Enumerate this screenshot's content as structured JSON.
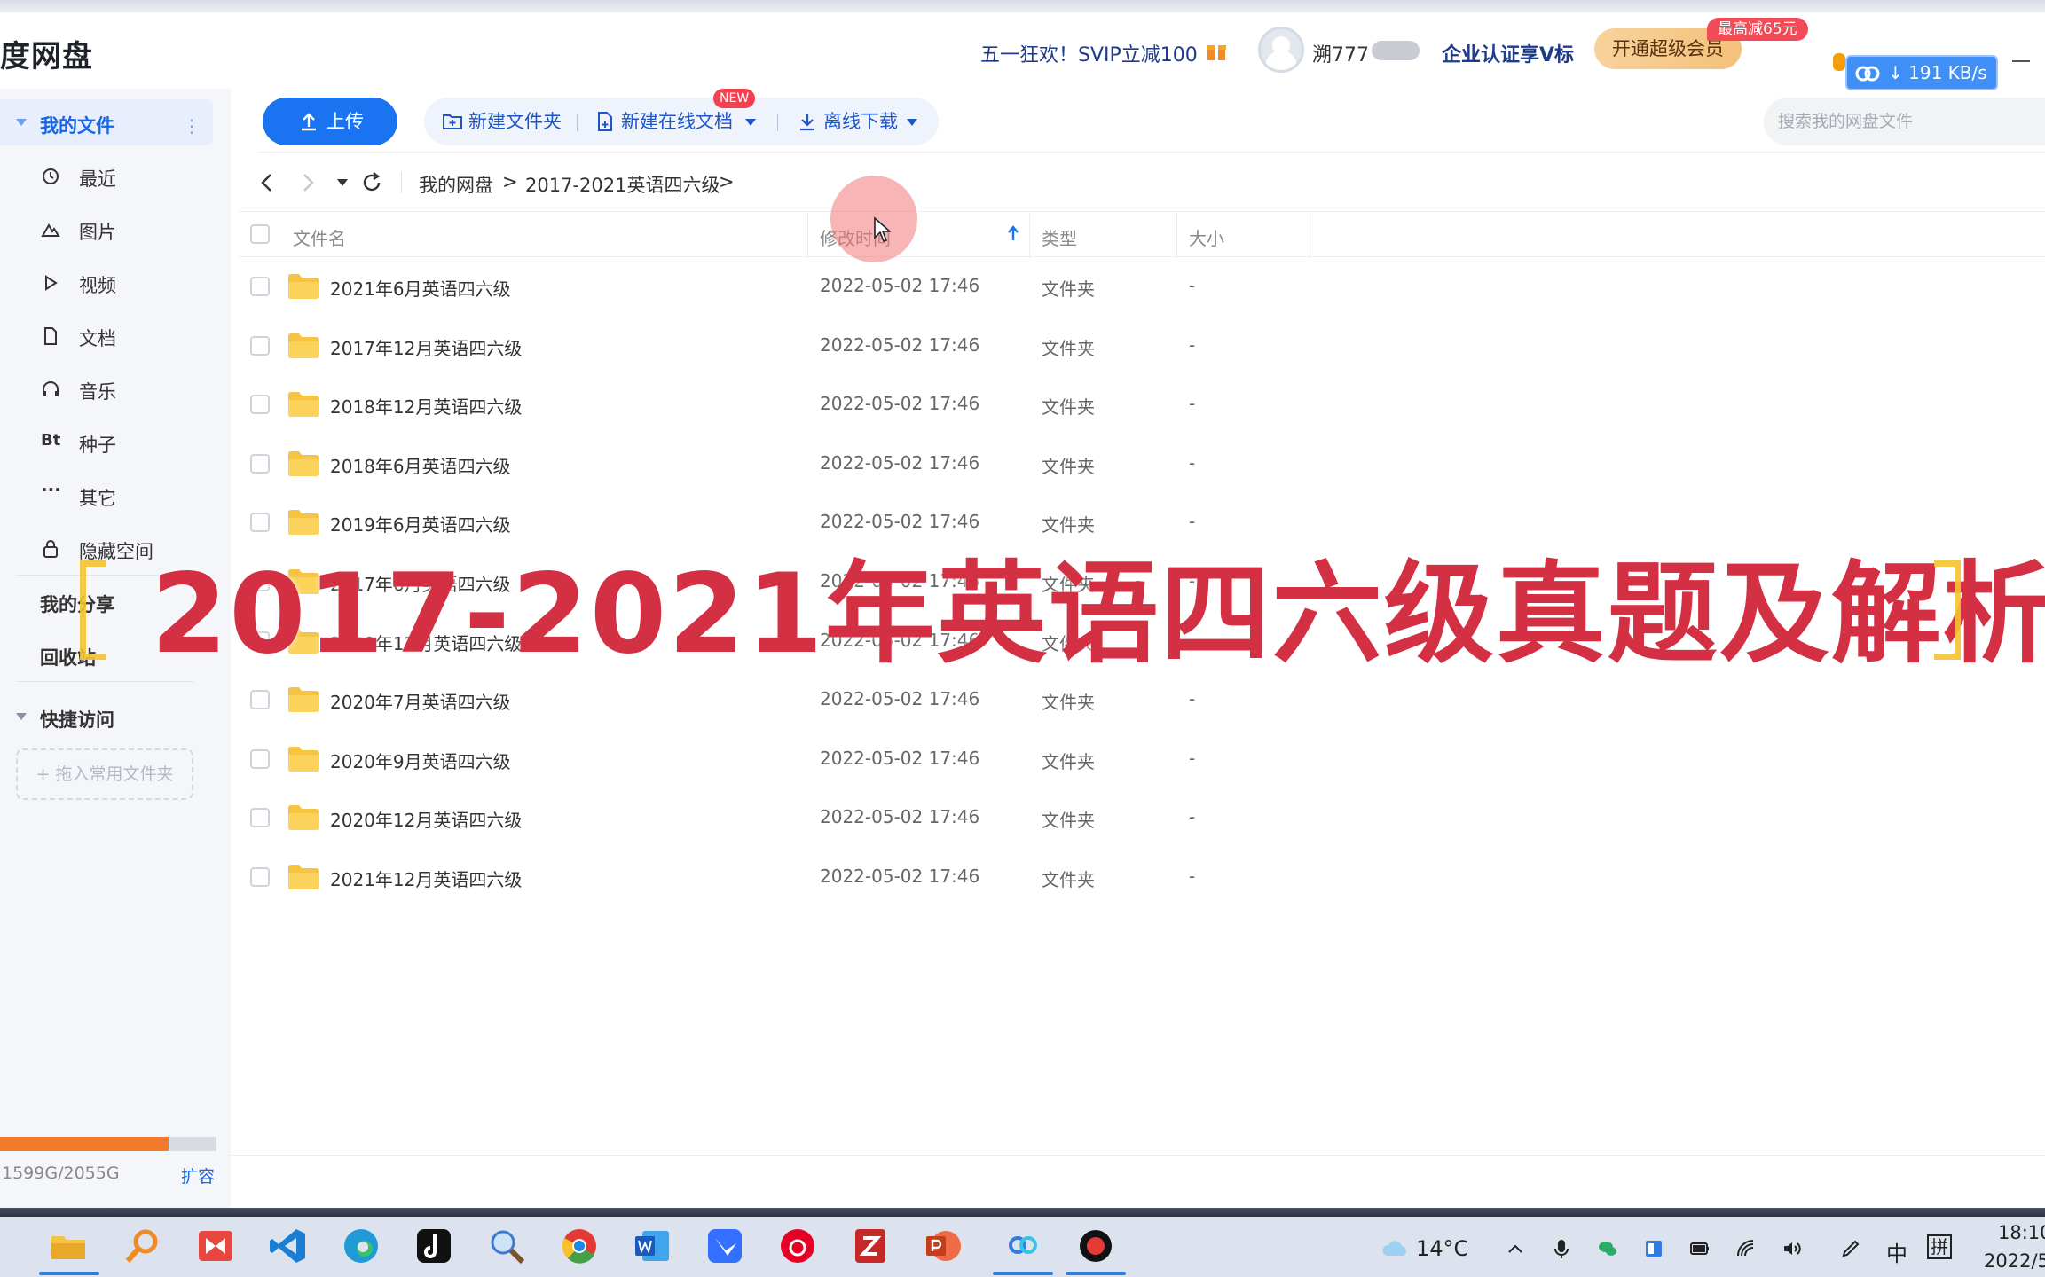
{
  "titlebar": {
    "app_title": "度网盘",
    "promo": "五一狂欢！SVIP立减100",
    "username": "溯777",
    "enterprise_label": "企业认证享V标",
    "svip_button": "开通超级会员",
    "discount_tag": "最高减65元",
    "download_speed": "191 KB/s"
  },
  "sidebar": {
    "my_files": "我的文件",
    "items": [
      {
        "label": "最近",
        "icon": "clock-icon"
      },
      {
        "label": "图片",
        "icon": "image-icon"
      },
      {
        "label": "视频",
        "icon": "play-icon"
      },
      {
        "label": "文档",
        "icon": "document-icon"
      },
      {
        "label": "音乐",
        "icon": "headphones-icon"
      },
      {
        "label": "种子",
        "icon": "bt-icon"
      },
      {
        "label": "其它",
        "icon": "more-icon"
      },
      {
        "label": "隐藏空间",
        "icon": "lock-icon"
      }
    ],
    "my_share": "我的分享",
    "recycle": "回收站",
    "quick_access": "快捷访问",
    "drop_zone": "+ 拖入常用文件夹",
    "bt_glyph": "Bt",
    "storage": "1599G/2055G",
    "storage_used_fraction": 0.778,
    "expand": "扩容"
  },
  "toolbar": {
    "upload": "上传",
    "new_folder": "新建文件夹",
    "new_online_doc": "新建在线文档",
    "new_badge": "NEW",
    "offline_download": "离线下载",
    "search_placeholder": "搜索我的网盘文件"
  },
  "breadcrumb": {
    "root": "我的网盘",
    "sep1": ">",
    "current": "2017-2021英语四六级",
    "sep2": ">"
  },
  "table": {
    "headers": {
      "name": "文件名",
      "modified": "修改时间",
      "type": "类型",
      "size": "大小"
    },
    "rows": [
      {
        "name": "2021年6月英语四六级",
        "modified": "2022-05-02 17:46",
        "type": "文件夹",
        "size": "-"
      },
      {
        "name": "2017年12月英语四六级",
        "modified": "2022-05-02 17:46",
        "type": "文件夹",
        "size": "-"
      },
      {
        "name": "2018年12月英语四六级",
        "modified": "2022-05-02 17:46",
        "type": "文件夹",
        "size": "-"
      },
      {
        "name": "2018年6月英语四六级",
        "modified": "2022-05-02 17:46",
        "type": "文件夹",
        "size": "-"
      },
      {
        "name": "2019年6月英语四六级",
        "modified": "2022-05-02 17:46",
        "type": "文件夹",
        "size": "-"
      },
      {
        "name": "2017年6月英语四六级",
        "modified": "2022-05-02 17:46",
        "type": "文件夹",
        "size": "-"
      },
      {
        "name": "2019年12月英语四六级",
        "modified": "2022-05-02 17:46",
        "type": "文件夹",
        "size": "-"
      },
      {
        "name": "2020年7月英语四六级",
        "modified": "2022-05-02 17:46",
        "type": "文件夹",
        "size": "-"
      },
      {
        "name": "2020年9月英语四六级",
        "modified": "2022-05-02 17:46",
        "type": "文件夹",
        "size": "-"
      },
      {
        "name": "2020年12月英语四六级",
        "modified": "2022-05-02 17:46",
        "type": "文件夹",
        "size": "-"
      },
      {
        "name": "2021年12月英语四六级",
        "modified": "2022-05-02 17:46",
        "type": "文件夹",
        "size": "-"
      }
    ]
  },
  "overlay_title": "2017-2021年英语四六级真题及解析",
  "taskbar": {
    "temperature": "14°C",
    "ime_lang": "中",
    "ime_mode": "拼",
    "time": "18:10",
    "date": "2022/5"
  },
  "colors": {
    "accent": "#1a73f0",
    "folder": "#f6c343",
    "overlay_text": "#d43044",
    "storage_fill": "#f47a2b"
  }
}
